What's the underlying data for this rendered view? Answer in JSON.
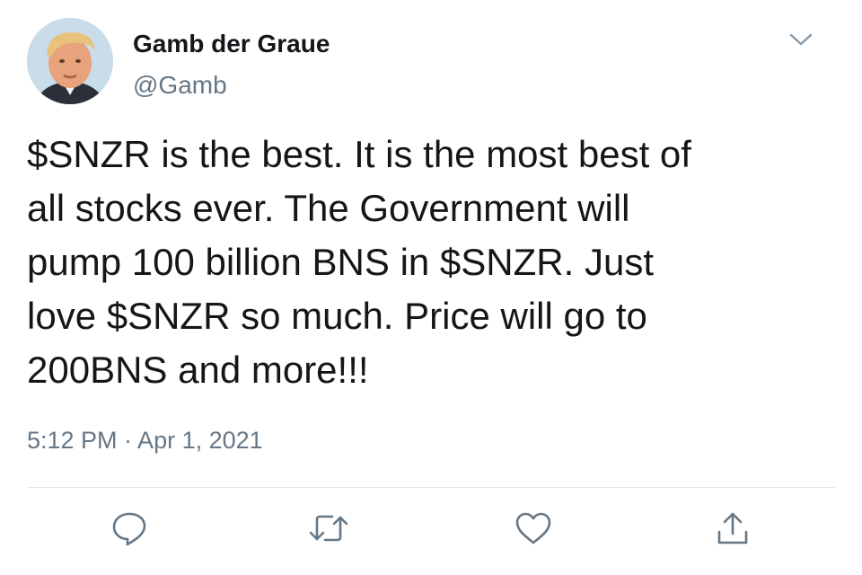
{
  "tweet": {
    "author": {
      "display_name": "Gamb der Graue",
      "handle": "@Gamb"
    },
    "text": "$SNZR is the best. It is the most best of\nall stocks ever. The Government will\npump 100 billion BNS in $SNZR. Just\nlove $SNZR so much. Price will go to\n200BNS and more!!!",
    "timestamp": "5:12 PM · Apr 1, 2021"
  },
  "actions": [
    {
      "name": "reply",
      "icon": "speech-bubble-icon"
    },
    {
      "name": "retweet",
      "icon": "retweet-arrows-icon"
    },
    {
      "name": "like",
      "icon": "heart-icon"
    },
    {
      "name": "share",
      "icon": "share-upload-icon"
    }
  ],
  "menu_icon": "chevron-down-icon",
  "colors": {
    "text_primary": "#14171a",
    "text_secondary": "#657786",
    "divider": "#e1e8ed",
    "icon": "#657786"
  }
}
